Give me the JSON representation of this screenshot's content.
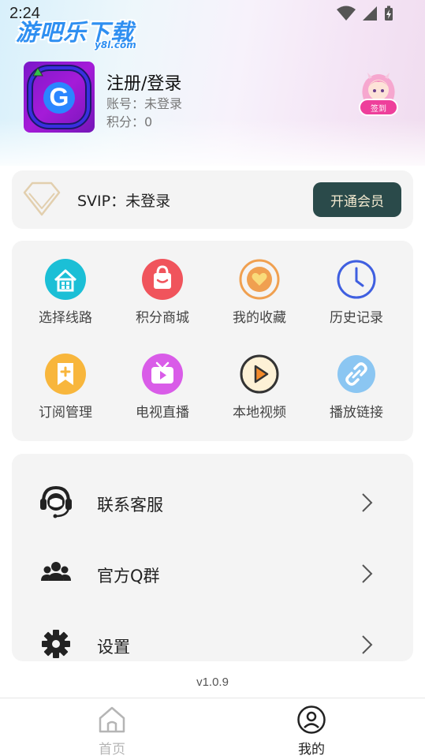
{
  "status_bar": {
    "time": "2:24"
  },
  "watermark": {
    "text": "游吧乐下载",
    "sub": "y8l.com"
  },
  "profile": {
    "title": "注册/登录",
    "account": "账号：未登录",
    "points": "积分：0",
    "mascot_badge": "签到"
  },
  "svip": {
    "label": "SVIP：未登录",
    "button": "开通会员"
  },
  "grid": [
    {
      "label": "选择线路",
      "icon": "route-icon",
      "color": "#1bbfd6"
    },
    {
      "label": "积分商城",
      "icon": "shopping-bag-icon",
      "color": "#f0545c"
    },
    {
      "label": "我的收藏",
      "icon": "heart-icon",
      "color": "#f0a050"
    },
    {
      "label": "历史记录",
      "icon": "clock-icon",
      "color": "#3f5fe0"
    },
    {
      "label": "订阅管理",
      "icon": "bookmark-plus-icon",
      "color": "#f8b63c"
    },
    {
      "label": "电视直播",
      "icon": "tv-icon",
      "color": "#d95ce8"
    },
    {
      "label": "本地视频",
      "icon": "play-circle-icon",
      "color": "#f38a2a"
    },
    {
      "label": "播放链接",
      "icon": "link-icon",
      "color": "#8bc6f2"
    }
  ],
  "list": [
    {
      "label": "联系客服",
      "icon": "customer-service-icon"
    },
    {
      "label": "官方Q群",
      "icon": "group-icon"
    },
    {
      "label": "设置",
      "icon": "gear-icon"
    }
  ],
  "version": "v1.0.9",
  "nav": [
    {
      "label": "首页",
      "icon": "home-icon",
      "active": false
    },
    {
      "label": "我的",
      "icon": "profile-icon",
      "active": true
    }
  ],
  "colors": {
    "svip_button_bg": "#2a4a4a",
    "svip_button_text": "#f3e9cf",
    "card_bg": "#f4f4f4",
    "nav_inactive": "#b5b5b5",
    "nav_active": "#222222"
  }
}
